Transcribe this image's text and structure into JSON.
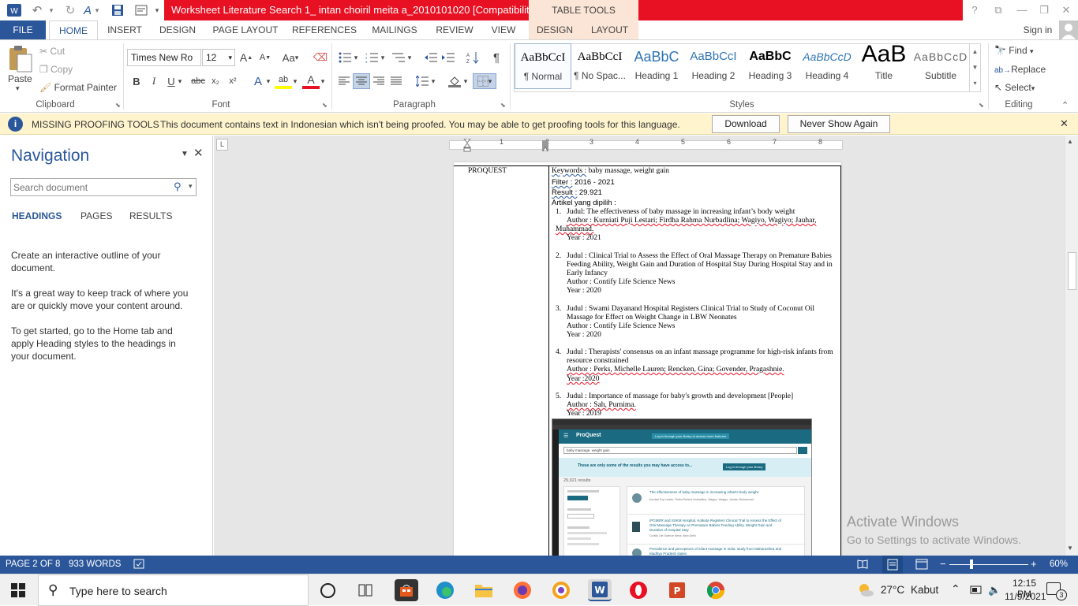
{
  "window": {
    "title": "Worksheet Literature Search 1_ intan choiril meita a_2010101020 [Compatibility M...",
    "context_group": "TABLE TOOLS",
    "controls": {
      "help": "?",
      "restore_ribbon": "⧉",
      "minimize": "—",
      "maximize": "❐",
      "close": "✕"
    }
  },
  "qat": {
    "word": "W",
    "undo": "↶",
    "redo": "↻",
    "save": "💾"
  },
  "tabs": {
    "file": "FILE",
    "home": "HOME",
    "insert": "INSERT",
    "design": "DESIGN",
    "page_layout": "PAGE LAYOUT",
    "references": "REFERENCES",
    "mailings": "MAILINGS",
    "review": "REVIEW",
    "view": "VIEW",
    "table_design": "DESIGN",
    "table_layout": "LAYOUT",
    "signin": "Sign in"
  },
  "ribbon": {
    "clipboard": {
      "paste": "Paste",
      "cut": "Cut",
      "copy": "Copy",
      "format_painter": "Format Painter",
      "label": "Clipboard"
    },
    "font": {
      "name": "Times New Ro",
      "size": "12",
      "label": "Font",
      "grow": "A",
      "shrink": "A",
      "case": "Aa",
      "bold": "B",
      "italic": "I",
      "underline": "U",
      "strike": "abc",
      "subscript": "x₂",
      "superscript": "x²",
      "effects": "A",
      "highlight": "ab",
      "color": "A"
    },
    "paragraph": {
      "label": "Paragraph",
      "pilcrow": "¶"
    },
    "styles": {
      "label": "Styles",
      "items": [
        {
          "preview": "AaBbCcI",
          "name": "¶ Normal"
        },
        {
          "preview": "AaBbCcI",
          "name": "¶ No Spac..."
        },
        {
          "preview": "AaBbC",
          "name": "Heading 1"
        },
        {
          "preview": "AaBbCcI",
          "name": "Heading 2"
        },
        {
          "preview": "AaBbC",
          "name": "Heading 3"
        },
        {
          "preview": "AaBbCcD",
          "name": "Heading 4"
        },
        {
          "preview": "AaB",
          "name": "Title"
        },
        {
          "preview": "AaBbCcD",
          "name": "Subtitle"
        }
      ]
    },
    "editing": {
      "find": "Find",
      "replace": "Replace",
      "select": "Select",
      "label": "Editing"
    }
  },
  "message_bar": {
    "title": "MISSING PROOFING TOOLS",
    "text": "This document contains text in Indonesian which isn't being proofed. You may be able to get proofing tools for this language.",
    "download": "Download",
    "never_show": "Never Show Again",
    "close": "✕"
  },
  "navigation": {
    "title": "Navigation",
    "search_placeholder": "Search document",
    "tabs": [
      "HEADINGS",
      "PAGES",
      "RESULTS"
    ],
    "paragraphs": [
      "Create an interactive outline of your document.",
      "It's a great way to keep track of where you are or quickly move your content around.",
      "To get started, go to the Home tab and apply Heading styles to the headings in your document."
    ]
  },
  "ruler": {
    "numbers": [
      "1",
      "2",
      "3",
      "4",
      "5",
      "6",
      "7",
      "8"
    ]
  },
  "document": {
    "source": "PROQUEST",
    "keywords_label": "Keywords :",
    "keywords": " baby massage, weight gain",
    "filter_label": "Filter :",
    "filter": " 2016 - 2021",
    "result_label": "Result :",
    "result": " 29.921",
    "selected": "Artikel yang dipilih :",
    "articles": [
      {
        "num": "1.",
        "lines": [
          "Judul: The effectiveness of baby massage in increasing infant’s body weight",
          "Author : Kurniati Puji Lestari; Firdha Rahma Nurbadlina; Wagiyo, Wagiyo; Jauhar,",
          "Muhammad.",
          "Year : 2021"
        ]
      },
      {
        "num": "2.",
        "lines": [
          "Judul : Clinical Trial to Assess the Effect of Oral Massage Therapy on Premature Babies",
          "Feeding Ability, Weight Gain and Duration of Hospital Stay During Hospital Stay and in",
          "Early Infancy",
          "Author : Contify Life Science News",
          "Year : 2020"
        ]
      },
      {
        "num": "3.",
        "lines": [
          "Judul : Swami Dayanand Hospital Registers Clinical Trial to Study of Coconut Oil",
          "Massage for Effect on Weight Change in LBW Neonates",
          "Author : Contify Life Science News",
          "Year : 2020"
        ]
      },
      {
        "num": "4.",
        "lines": [
          "Judul : Therapists' consensus on an infant massage programme for high-risk infants from",
          "resource constrained",
          "Author : Perks, Michelle Lauren; Rencken, Gina; Govender, Pragashnie.",
          "Year :2020"
        ]
      },
      {
        "num": "5.",
        "lines": [
          "Judul : Importance of massage for baby's growth and development [People]",
          "Author : Sah, Purnima.",
          "Year : 2019"
        ]
      }
    ],
    "screenshot": {
      "brand": "ProQuest",
      "login_banner": "Log in through your library to access more features",
      "search_value": "baby massage, weight gain",
      "notice": "These are only some of the results you may have access to...",
      "notice_btn": "Log in through your library",
      "result_count": "29,921 results",
      "results": [
        {
          "title": "The effectiveness of baby massage in increasing infant's body weight",
          "meta": "Kurniati Puji Lestari, Firdha Rahma Nurbadlina, Wagiyo, Wagiyo; Jauhar, Muhammad"
        },
        {
          "title": "IPGMER and SSKM Hospital, Kolkata Registers Clinical Trial to Assess the Effect of Oral Massage Therapy on Premature Babies Feeding Ability, Weight Gain and Duration of Hospital Stay",
          "meta": "Contify Life Science News; New Delhi"
        },
        {
          "title": "Prevalence and perceptions of infant massage in India: study from Maharashtra and Madhya Pradesh states",
          "meta": ""
        }
      ]
    }
  },
  "watermark": {
    "title": "Activate Windows",
    "subtitle": "Go to Settings to activate Windows."
  },
  "status": {
    "page": "PAGE 2 OF 8",
    "words": "933 WORDS",
    "zoom": "60%",
    "minus": "−",
    "plus": "+"
  },
  "taskbar": {
    "search_placeholder": "Type here to search",
    "weather_temp": "27°C",
    "weather_desc": "Kabut",
    "time": "12:15 PM",
    "date": "11/9/2021",
    "notifications": "3"
  }
}
